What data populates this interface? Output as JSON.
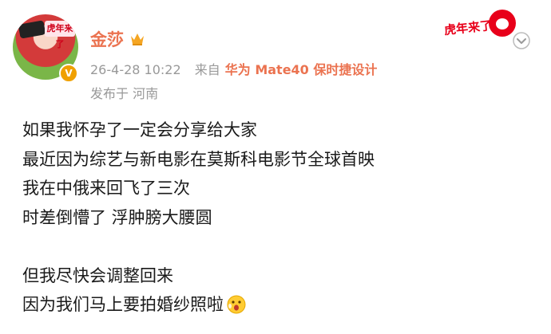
{
  "post": {
    "avatar_flag_text": "虎年来了",
    "author": "金莎",
    "timestamp": "26-4-28 10:22",
    "source_prefix": "来自",
    "source_name": "华为 Mate40 保时捷设计",
    "location": "发布于 河南",
    "sticker_text": "虎年来了",
    "lines": [
      "如果我怀孕了一定会分享给大家",
      "最近因为综艺与新电影在莫斯科电影节全球首映",
      "我在中俄来回飞了三次",
      "时差倒懵了 浮肿膀大腰圆",
      "",
      "但我尽快会调整回来",
      "因为我们马上要拍婚纱照啦"
    ]
  },
  "icons": {
    "verified": "verified-badge-icon",
    "crown": "crown-icon",
    "more": "chevron-down-icon",
    "emoji": "surprised-emoji-icon"
  },
  "colors": {
    "accent": "#eb7350",
    "meta": "#999999",
    "text": "#1a1a1a"
  }
}
